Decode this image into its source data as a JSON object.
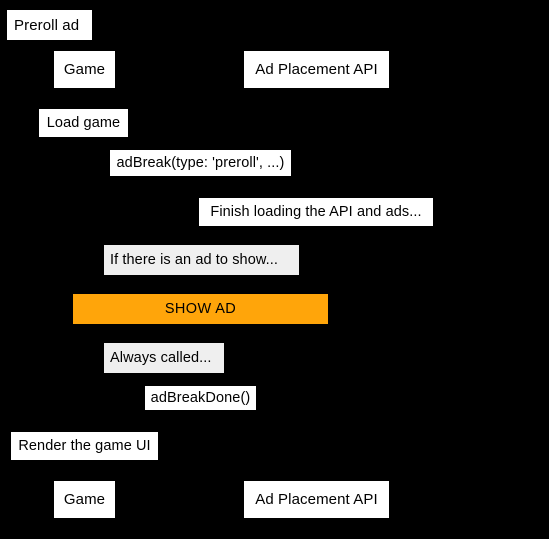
{
  "diagram": {
    "type": "sequence-diagram",
    "title": "Preroll ad",
    "background_color": "#000000",
    "label_background_color": "#ffffff",
    "fragment_background_color": "#efefef",
    "highlight_color": "#ffa50a",
    "text_color": "#000000",
    "participants": [
      {
        "id": "game",
        "label": "Game"
      },
      {
        "id": "ad-placement-api",
        "label": "Ad Placement API"
      }
    ],
    "participants_footer": [
      {
        "id": "game",
        "label": "Game"
      },
      {
        "id": "ad-placement-api",
        "label": "Ad Placement API"
      }
    ],
    "steps": [
      {
        "id": "load-game",
        "label": "Load game",
        "kind": "message"
      },
      {
        "id": "ad-break-call",
        "label": "adBreak(type: 'preroll', ...)",
        "kind": "message"
      },
      {
        "id": "finish-loading",
        "label": "Finish loading the API and ads...",
        "kind": "message"
      },
      {
        "id": "if-there-is-an-ad",
        "label": "If there is an ad to show...",
        "kind": "fragment"
      },
      {
        "id": "show-ad",
        "label": "SHOW AD",
        "kind": "highlight"
      },
      {
        "id": "always-called",
        "label": "Always called...",
        "kind": "fragment"
      },
      {
        "id": "ad-break-done",
        "label": "adBreakDone()",
        "kind": "message"
      },
      {
        "id": "render-game-ui",
        "label": "Render the game UI",
        "kind": "message"
      }
    ]
  }
}
